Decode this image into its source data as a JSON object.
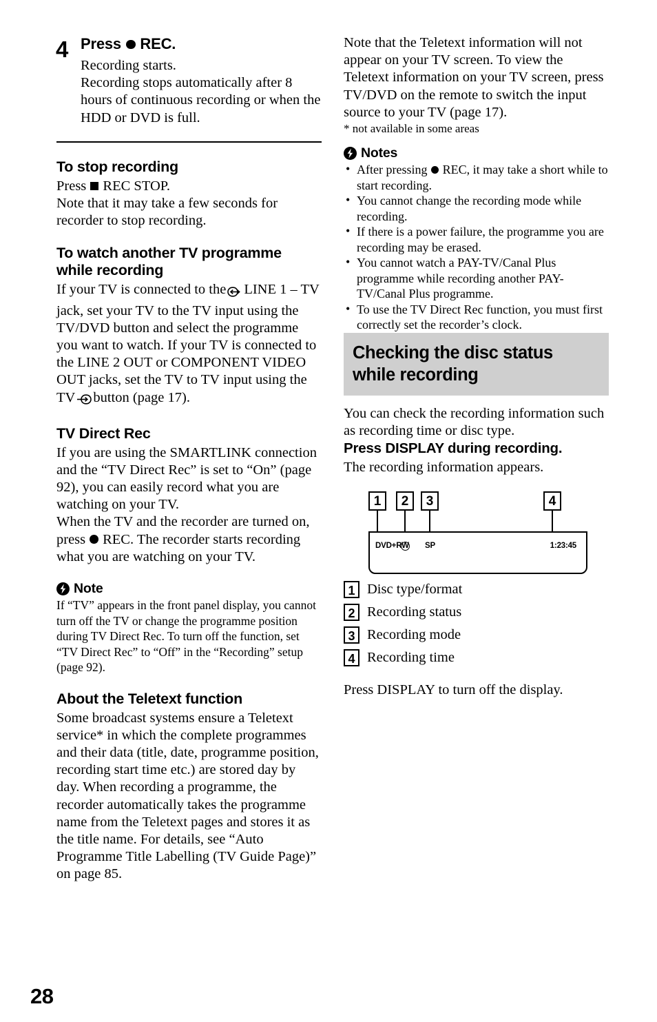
{
  "page": {
    "number": "28"
  },
  "left_column": {
    "step": {
      "number": "4",
      "title_before": "Press",
      "title_icon": "rec-dot-icon",
      "title_after": "REC.",
      "desc_line1": "Recording starts.",
      "desc_line2": "Recording stops automatically after 8 hours of continuous recording or when the HDD or DVD is full."
    },
    "sections": [
      {
        "heading": "To stop recording",
        "paragraph_1_before": "Press",
        "paragraph_1_icon": "stop-square-icon",
        "paragraph_1_after": "REC STOP.",
        "paragraph_2": "Note that it may take a few seconds for recorder to stop recording."
      },
      {
        "heading": "To watch another TV programme while recording",
        "paragraph_part1": "If your TV is connected to the",
        "icon_1": "line-jack-icon",
        "paragraph_part2": "LINE 1 – TV jack, set your TV to the TV input using the TV/DVD button and select the programme you want to watch. If your TV is connected to the LINE 2 OUT or COMPONENT VIDEO OUT jacks, set the TV to TV input using the TV",
        "icon_2": "tv-input-icon",
        "paragraph_part3": "button (page 17)."
      },
      {
        "heading": "TV Direct Rec",
        "paragraph_1": "If you are using the SMARTLINK connection and the “TV Direct Rec” is set to “On” (page 92), you can easily record what you are watching on your TV.",
        "paragraph_2_part1": "When the TV and the recorder are turned on, press",
        "paragraph_2_icon": "rec-dot-icon",
        "paragraph_2_part2": "REC. The recorder starts recording what you are watching on your TV."
      }
    ],
    "note": {
      "icon": "flash-icon",
      "label": "Note",
      "body": "If “TV” appears in the front panel display, you cannot turn off the TV or change the programme position during TV Direct Rec. To turn off the function, set “TV Direct Rec” to “Off” in the “Recording” setup (page 92)."
    },
    "teletext": {
      "heading": "About the Teletext function",
      "body": "Some broadcast systems ensure a Teletext service* in which the complete programmes and their data (title, date, programme position, recording start time etc.) are stored day by day. When recording a programme, the recorder automatically takes the programme name from the Teletext pages and stores it as the title name. For details, see “Auto Programme Title Labelling (TV Guide Page)” on page 85."
    }
  },
  "right_column": {
    "intro_paragraph": "Note that the Teletext information will not appear on your TV screen. To view the Teletext information on your TV screen, press TV/DVD on the remote to switch the input source to your TV (page 17).",
    "footnote": "* not available in some areas",
    "notes": {
      "icon": "flash-icon",
      "label": "Notes",
      "items": [
        {
          "before": "After pressing",
          "icon": "rec-dot-icon",
          "after": "REC, it may take a short while to start recording."
        },
        {
          "before": "",
          "icon": "",
          "after": "You cannot change the recording mode while recording."
        },
        {
          "before": "",
          "icon": "",
          "after": "If there is a power failure, the programme you are recording may be erased."
        },
        {
          "before": "",
          "icon": "",
          "after": "You cannot watch a PAY-TV/Canal Plus programme while recording another PAY-TV/Canal Plus programme."
        },
        {
          "before": "",
          "icon": "",
          "after": "To use the TV Direct Rec function, you must first correctly set the recorder’s clock."
        }
      ]
    },
    "grey_heading": "Checking the disc status while recording",
    "intro_2": "You can check the recording information such as recording time or disc type.",
    "subheading": "Press DISPLAY during recording.",
    "subheading_desc": "The recording information appears.",
    "figure": {
      "callouts": [
        "1",
        "2",
        "3",
        "4"
      ],
      "display": {
        "disc_type": "DVD+RW",
        "recording_status_icon": "circle-icon",
        "recording_mode": "SP",
        "recording_time": "1:23:45"
      }
    },
    "legend": [
      {
        "num": "1",
        "label": "Disc type/format"
      },
      {
        "num": "2",
        "label": "Recording status"
      },
      {
        "num": "3",
        "label": "Recording mode"
      },
      {
        "num": "4",
        "label": "Recording time"
      }
    ],
    "closing_paragraph": "Press DISPLAY to turn off the display."
  }
}
